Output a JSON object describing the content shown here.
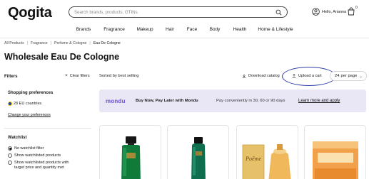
{
  "header": {
    "logo": "Qogita",
    "search_placeholder": "Search brands, products, GTINs",
    "account_greeting": "Hello, Arianna",
    "cart_count": "0"
  },
  "nav": {
    "items": [
      "Brands",
      "Fragrance",
      "Makeup",
      "Hair",
      "Face",
      "Body",
      "Health",
      "Home & Lifestyle"
    ]
  },
  "breadcrumb": [
    "All Products",
    "Fragrance",
    "Perfume & Cologne",
    "Eau De Cologne"
  ],
  "page": {
    "title": "Wholesale Eau De Cologne"
  },
  "toolbar": {
    "filters": "Filters",
    "clear_filters": "Clear filters",
    "sort": "Sorted by best selling",
    "download_catalog": "Download catalog",
    "upload_cart": "Upload a cart",
    "per_page_value": "24",
    "per_page_label": "per page"
  },
  "sidebar": {
    "shopping_preferences": "Shopping preferences",
    "countries": "28 EU countries",
    "change_preferences": "Change your preferences",
    "watchlist_title": "Watchlist",
    "watchlist_options": [
      {
        "label": "No watchlist filter",
        "selected": true
      },
      {
        "label": "Show watchlisted products",
        "selected": false
      },
      {
        "label": "Show watchlisted products with target price and quantity met",
        "selected": false
      }
    ],
    "watch_opt3_line1": "Show watchlisted products with",
    "watch_opt3_line2": "target price and quantity met"
  },
  "banner": {
    "logo": "mondu",
    "headline": "Buy Now, Pay Later with Mondu",
    "text": "Pay conveniently in 30, 60 or 90 days",
    "link": "Learn more and apply"
  },
  "products": [
    {
      "name": "green-bottle-perfume"
    },
    {
      "name": "green-bottle-perfume-small"
    },
    {
      "name": "poeme-perfume",
      "label": "Poême"
    },
    {
      "name": "orange-box-perfume"
    }
  ],
  "colors": {
    "accent_purple": "#6b4ed8",
    "banner_bg": "#e9e6f6",
    "annotation_oval": "#2b3ca8"
  }
}
